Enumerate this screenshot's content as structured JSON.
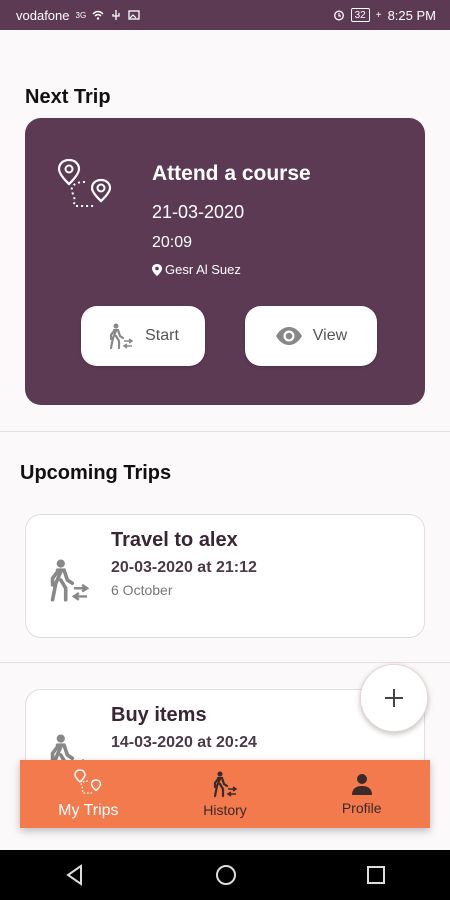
{
  "status_bar": {
    "carrier": "vodafone",
    "network": "3G",
    "battery": "32",
    "time": "8:25 PM"
  },
  "next_trip": {
    "section_title": "Next Trip",
    "title": "Attend a course",
    "date": "21-03-2020",
    "time": "20:09",
    "location": "Gesr Al Suez",
    "start_label": "Start",
    "view_label": "View"
  },
  "upcoming": {
    "section_title": "Upcoming Trips",
    "trips": [
      {
        "title": "Travel to alex",
        "datetime": "20-03-2020 at 21:12",
        "location": "6 October"
      },
      {
        "title": "Buy items",
        "datetime": "14-03-2020 at 20:24",
        "location": ""
      }
    ]
  },
  "nav": {
    "items": [
      {
        "label": "My Trips",
        "icon": "route-icon",
        "active": true
      },
      {
        "label": "History",
        "icon": "walking-icon",
        "active": false
      },
      {
        "label": "Profile",
        "icon": "person-icon",
        "active": false
      }
    ]
  },
  "fab": {
    "icon": "plus-icon"
  },
  "colors": {
    "primary": "#5d3a54",
    "accent": "#f27a4c",
    "background": "#fbf9fa"
  }
}
